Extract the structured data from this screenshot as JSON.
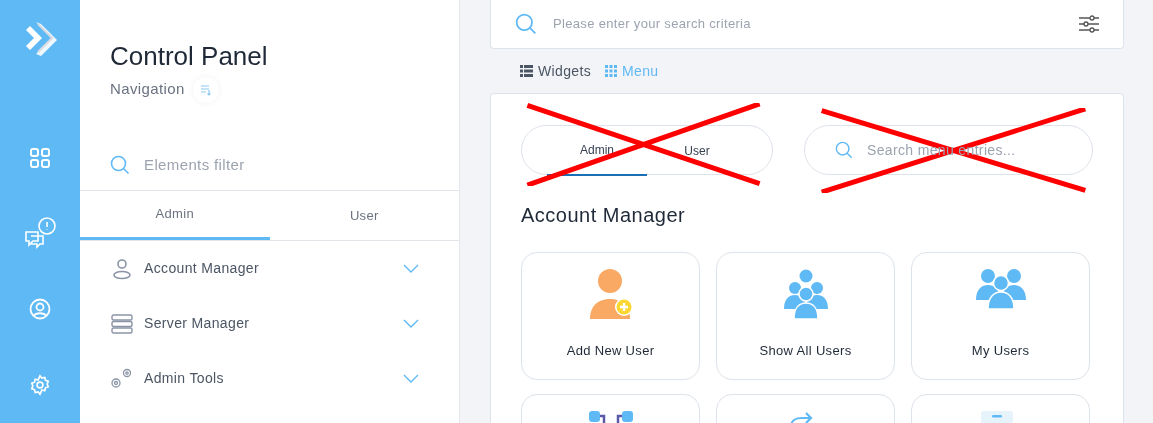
{
  "sidebar": {
    "items": [
      {
        "kind": "grid"
      },
      {
        "kind": "chat-alert"
      },
      {
        "kind": "user"
      },
      {
        "kind": "settings"
      }
    ]
  },
  "panel": {
    "title": "Control Panel",
    "subtitle": "Navigation",
    "filter": {
      "placeholder": "Elements filter"
    },
    "tabs": [
      {
        "label": "Admin",
        "selected": true
      },
      {
        "label": "User",
        "selected": false
      }
    ],
    "items": [
      {
        "label": "Account Manager",
        "kind": "user",
        "expanded": false
      },
      {
        "label": "Server Manager",
        "kind": "server",
        "expanded": false
      },
      {
        "label": "Admin Tools",
        "kind": "gears",
        "expanded": false
      }
    ]
  },
  "search": {
    "placeholder": "Please enter your search criteria"
  },
  "views": [
    {
      "label": "Widgets",
      "kind": "list",
      "selected": false
    },
    {
      "label": "Menu",
      "kind": "grid",
      "selected": true
    }
  ],
  "menu": {
    "tabs": {
      "crossed_out": true,
      "items": [
        {
          "label": "Admin",
          "selected": true
        },
        {
          "label": "User",
          "selected": false
        }
      ]
    },
    "search": {
      "placeholder": "Search menu entries...",
      "crossed_out": true
    },
    "section_title": "Account Manager",
    "tiles": [
      {
        "label": "Add New User",
        "kind": "add-user"
      },
      {
        "label": "Show All Users",
        "kind": "all-users"
      },
      {
        "label": "My Users",
        "kind": "my-users"
      },
      {
        "kind": "workflow"
      },
      {
        "kind": "share-user"
      },
      {
        "kind": "document"
      }
    ]
  }
}
